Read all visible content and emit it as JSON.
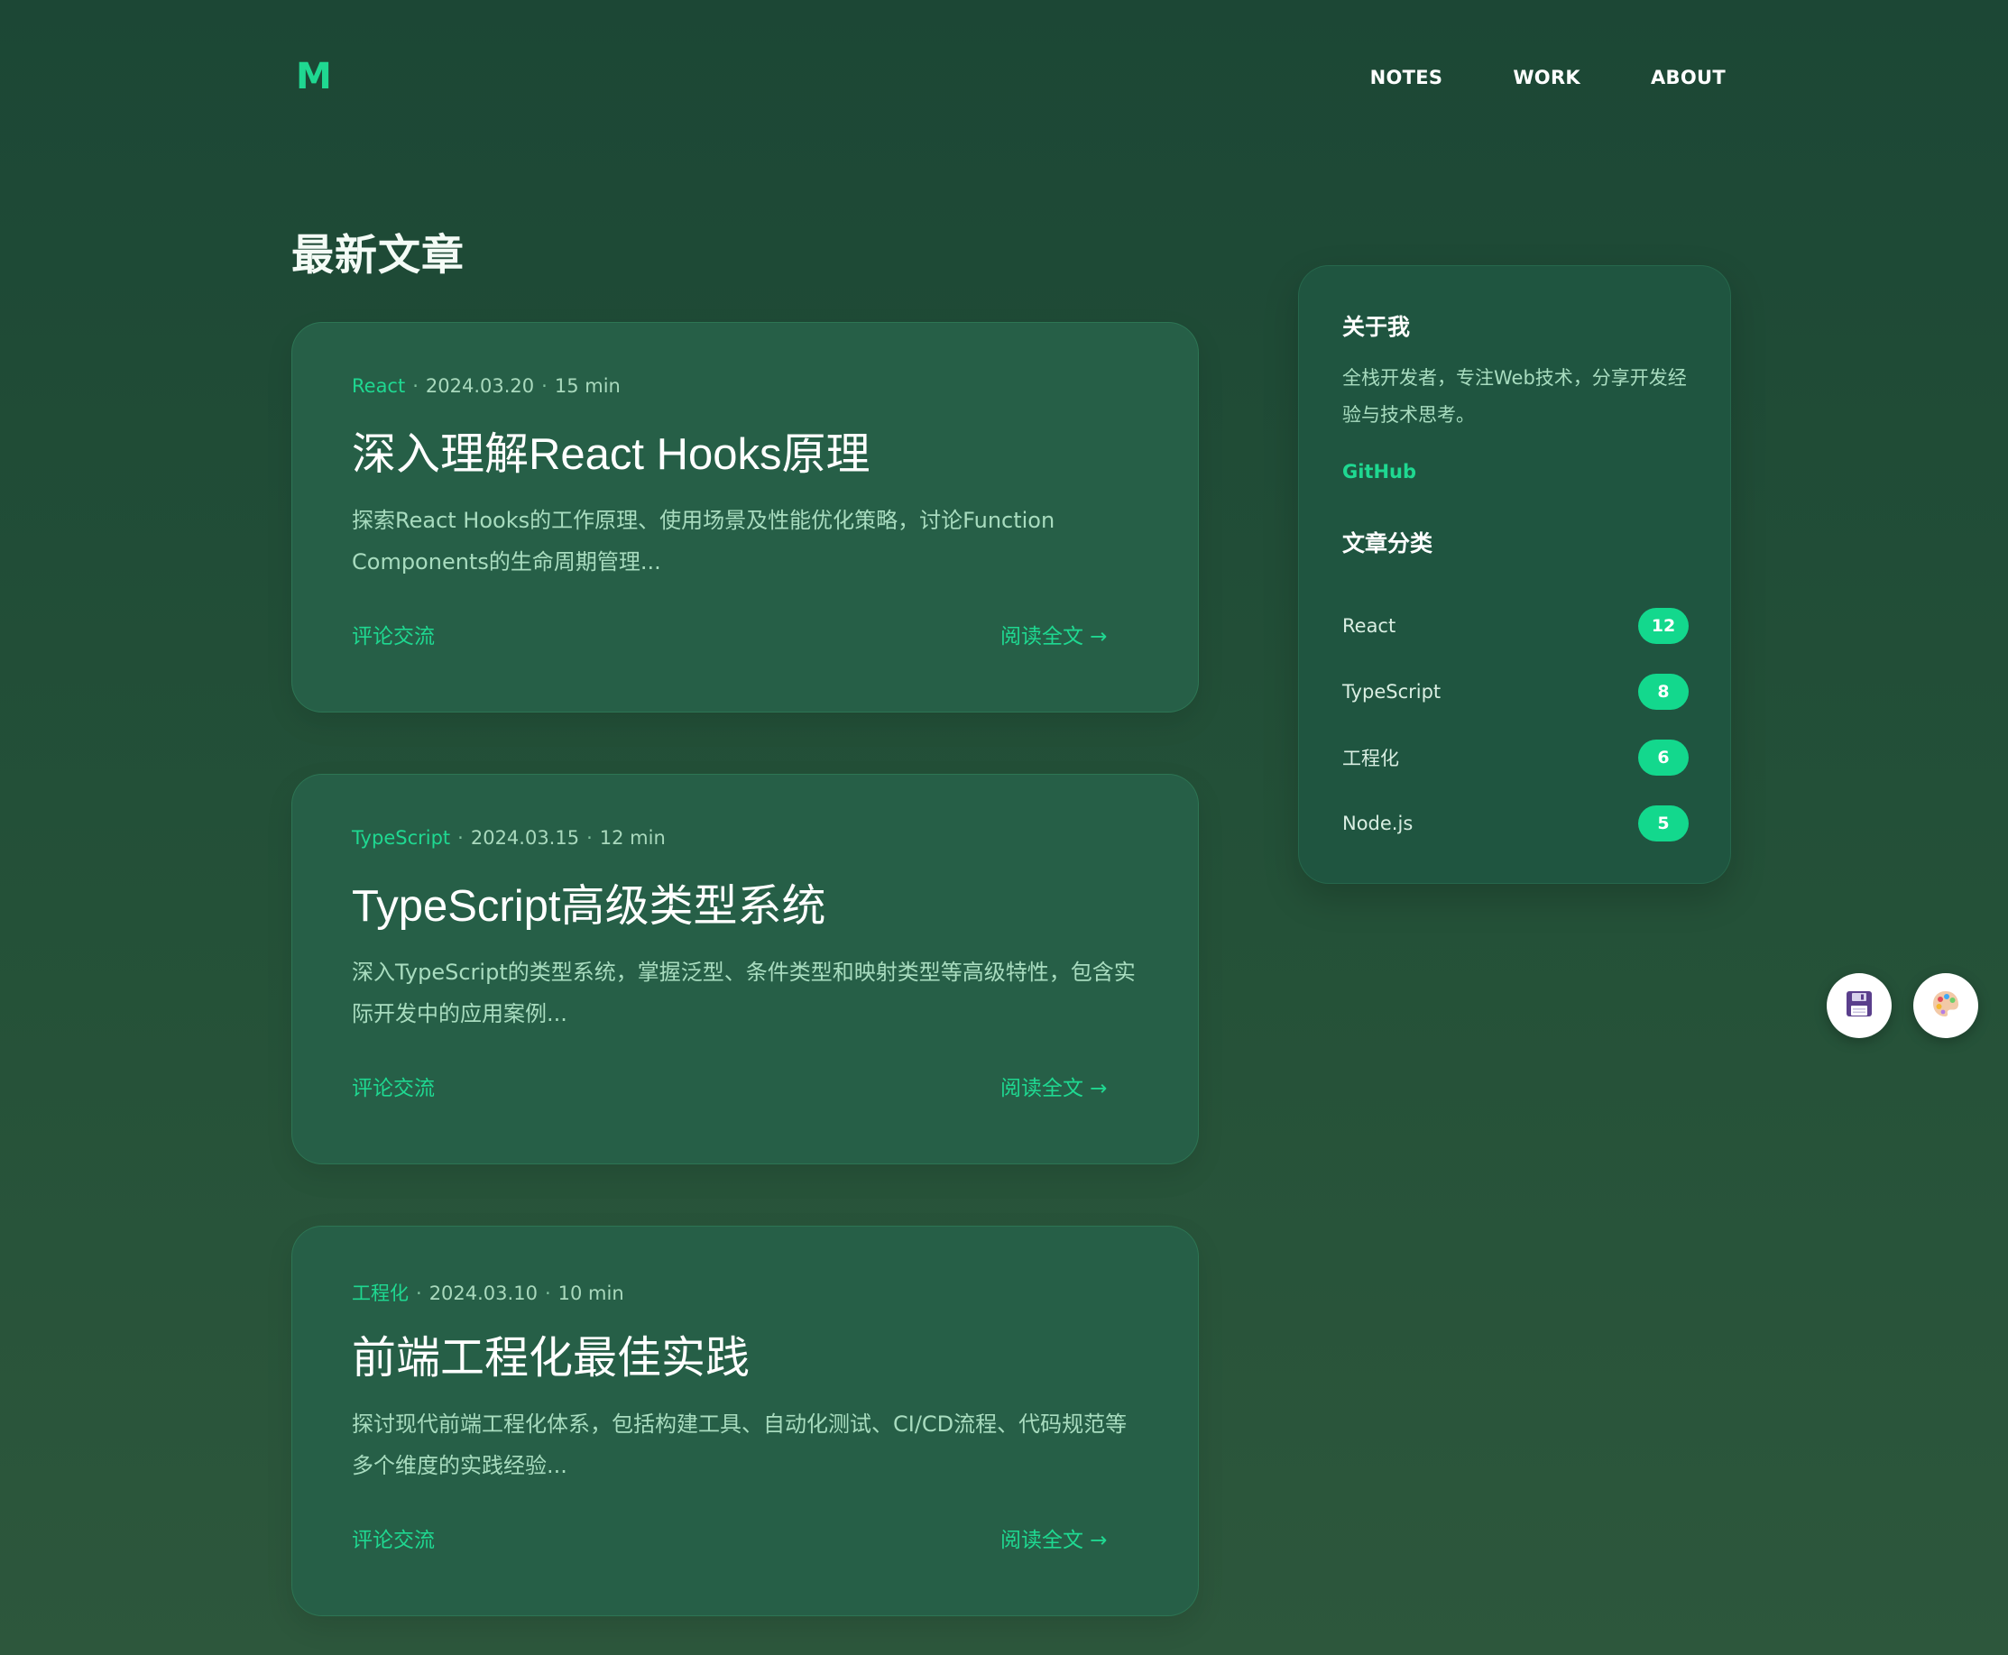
{
  "header": {
    "logo": "M",
    "nav": [
      "NOTES",
      "WORK",
      "ABOUT"
    ]
  },
  "main": {
    "section_title": "最新文章",
    "posts": [
      {
        "category": "React",
        "date": "2024.03.20",
        "read_time": "15 min",
        "title": "深入理解React Hooks原理",
        "excerpt": "探索React Hooks的工作原理、使用场景及性能优化策略，讨论Function Components的生命周期管理...",
        "comment_label": "评论交流",
        "read_label": "阅读全文 →"
      },
      {
        "category": "TypeScript",
        "date": "2024.03.15",
        "read_time": "12 min",
        "title": "TypeScript高级类型系统",
        "excerpt": "深入TypeScript的类型系统，掌握泛型、条件类型和映射类型等高级特性，包含实际开发中的应用案例...",
        "comment_label": "评论交流",
        "read_label": "阅读全文 →"
      },
      {
        "category": "工程化",
        "date": "2024.03.10",
        "read_time": "10 min",
        "title": "前端工程化最佳实践",
        "excerpt": "探讨现代前端工程化体系，包括构建工具、自动化测试、CI/CD流程、代码规范等多个维度的实践经验...",
        "comment_label": "评论交流",
        "read_label": "阅读全文 →"
      }
    ]
  },
  "sidebar": {
    "about_title": "关于我",
    "about_text": "全栈开发者，专注Web技术，分享开发经验与技术思考。",
    "github_label": "GitHub",
    "categories_title": "文章分类",
    "categories": [
      {
        "name": "React",
        "count": "12"
      },
      {
        "name": "TypeScript",
        "count": "8"
      },
      {
        "name": "工程化",
        "count": "6"
      },
      {
        "name": "Node.js",
        "count": "5"
      }
    ]
  },
  "floating": {
    "save_icon": "floppy-disk-icon",
    "theme_icon": "palette-icon"
  },
  "colors": {
    "accent": "#1fd891",
    "card_bg": "#265f47",
    "page_bg": "#1c4735"
  }
}
